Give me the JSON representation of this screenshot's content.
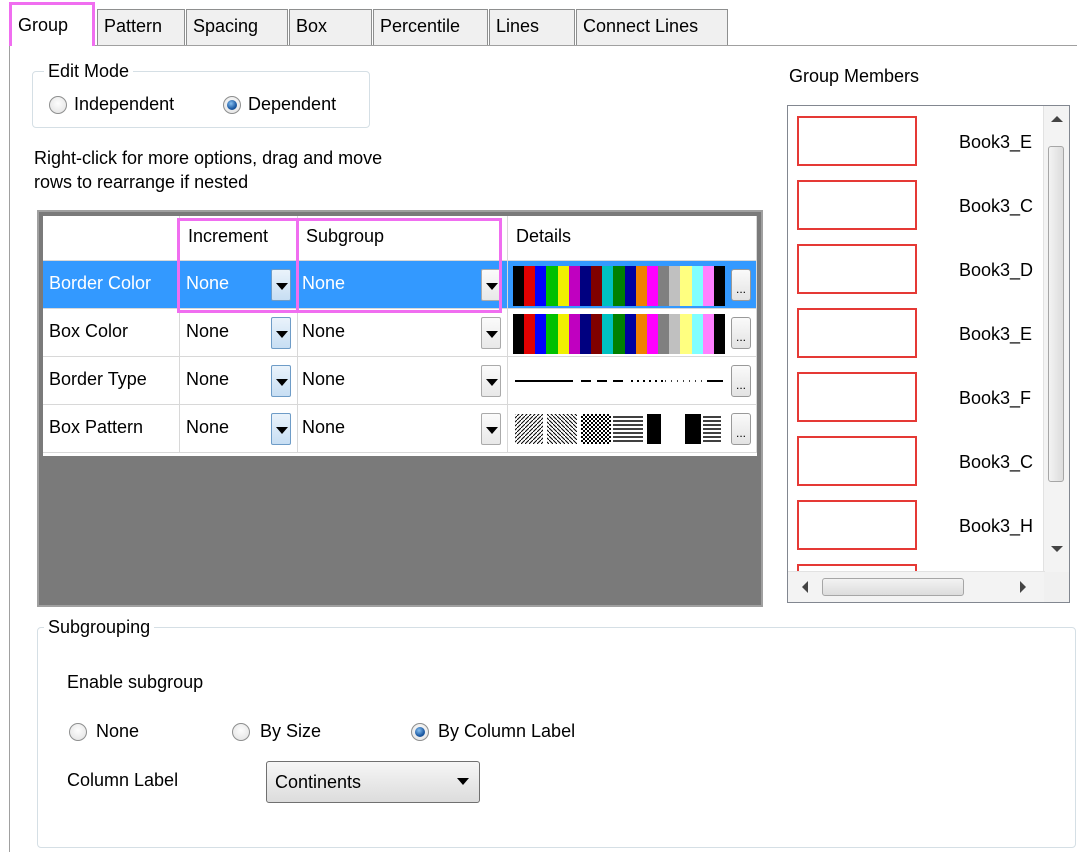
{
  "tabs": [
    "Group",
    "Pattern",
    "Spacing",
    "Box",
    "Percentile",
    "Lines",
    "Connect Lines"
  ],
  "edit_mode": {
    "title": "Edit Mode",
    "options": [
      "Independent",
      "Dependent"
    ],
    "selected": "Dependent"
  },
  "hint": {
    "line1": "Right-click for more options, drag and move",
    "line2": "rows to  rearrange if nested"
  },
  "grid": {
    "headers": [
      "",
      "Increment",
      "Subgroup",
      "Details"
    ],
    "rows": [
      {
        "label": "Border Color",
        "increment": "None",
        "subgroup": "None",
        "detail": "colors"
      },
      {
        "label": "Box Color",
        "increment": "None",
        "subgroup": "None",
        "detail": "colors"
      },
      {
        "label": "Border Type",
        "increment": "None",
        "subgroup": "None",
        "detail": "lines"
      },
      {
        "label": "Box Pattern",
        "increment": "None",
        "subgroup": "None",
        "detail": "patterns"
      }
    ],
    "selected_row": "Border Color",
    "dots_label": "...",
    "color_list": [
      "#000000",
      "#e00000",
      "#0000ff",
      "#00c000",
      "#f0f000",
      "#c000c0",
      "#000080",
      "#800000",
      "#00c0c0",
      "#008000",
      "#0000a0",
      "#f08000",
      "#ff00ff",
      "#808080",
      "#c0c0c0",
      "#ffff80",
      "#80ffff",
      "#ff80ff",
      "#000000"
    ],
    "accent": "#3399ff"
  },
  "group_members": {
    "title": "Group Members",
    "items": [
      "Book3_E",
      "Book3_C",
      "Book3_D",
      "Book3_E",
      "Book3_F",
      "Book3_C",
      "Book3_H"
    ],
    "box_color": "#e53935"
  },
  "subgrouping": {
    "title": "Subgrouping",
    "enable_label": "Enable subgroup",
    "options": [
      "None",
      "By Size",
      "By Column Label"
    ],
    "selected": "By Column Label",
    "column_label": "Column Label",
    "column_value": "Continents"
  },
  "highlight_color": "#f06ef0"
}
